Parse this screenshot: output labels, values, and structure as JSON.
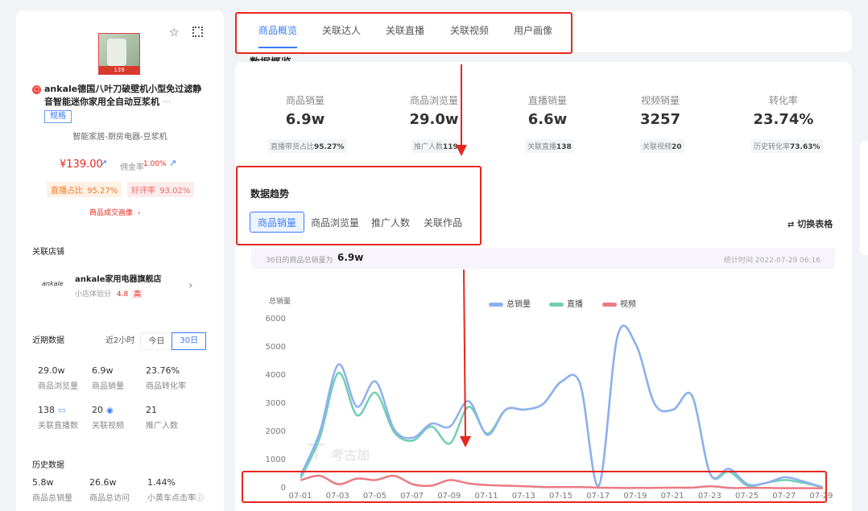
{
  "product": {
    "title": "ankale德国八叶刀破壁机小型免过滤静音智能迷你家用全自动豆浆机",
    "more": "···",
    "spec_tag": "规格",
    "category": "智能家居-厨房电器-豆浆机",
    "price": "¥139.00",
    "commission_label": "佣金率",
    "commission_value": "1.00%",
    "live_ratio_label": "直播占比",
    "live_ratio_value": "95.27%",
    "good_rate_label": "好评率",
    "good_rate_value": "93.02%",
    "deal_portrait_link": "商品成交画像",
    "image_text": "139"
  },
  "shop": {
    "section_title": "关联店铺",
    "logo_text": "ankale",
    "name": "ankale家用电器旗舰店",
    "score_label": "小店体验分",
    "score_value": "4.8",
    "score_level": "高"
  },
  "recent": {
    "section_title": "近期数据",
    "ranges": [
      "近2小时",
      "今日",
      "30日"
    ],
    "active_range": "30日",
    "stats": [
      {
        "value": "29.0w",
        "label": "商品浏览量"
      },
      {
        "value": "6.9w",
        "label": "商品销量"
      },
      {
        "value": "23.76%",
        "label": "商品转化率"
      },
      {
        "value": "138",
        "label": "关联直播数"
      },
      {
        "value": "20",
        "label": "关联视频"
      },
      {
        "value": "21",
        "label": "推广人数"
      }
    ]
  },
  "history": {
    "section_title": "历史数据",
    "stats": [
      {
        "value": "5.8w",
        "label": "商品总销量"
      },
      {
        "value": "26.6w",
        "label": "商品总访问"
      },
      {
        "value": "1.44%",
        "label": "小黄车点击率"
      }
    ]
  },
  "tabs": [
    "商品概览",
    "关联达人",
    "关联直播",
    "关联视频",
    "用户画像"
  ],
  "active_tab": "商品概览",
  "overview": {
    "heading_partial": "数据概览",
    "metrics": [
      {
        "label": "商品销量",
        "value": "6.9w",
        "sub_label": "直播带货占比",
        "sub_value": "95.27%"
      },
      {
        "label": "商品浏览量",
        "value": "29.0w",
        "sub_label": "推广人数",
        "sub_value": "119"
      },
      {
        "label": "直播销量",
        "value": "6.6w",
        "sub_label": "关联直播",
        "sub_value": "138"
      },
      {
        "label": "视频销量",
        "value": "3257",
        "sub_label": "关联视频",
        "sub_value": "20"
      },
      {
        "label": "转化率",
        "value": "23.74%",
        "sub_label": "历史转化率",
        "sub_value": "73.63%"
      }
    ]
  },
  "trend": {
    "title": "数据趋势",
    "subtabs": [
      "商品销量",
      "商品浏览量",
      "推广人数",
      "关联作品"
    ],
    "active_subtab": "商品销量",
    "toggle_table": "切换表格",
    "summary_label": "30日的商品总销量为",
    "summary_value": "6.9w",
    "stat_time": "统计时间 2022-07-29 06:16",
    "watermark": "考古加"
  },
  "colors": {
    "accent": "#3c7bf5",
    "annotation_red": "#e8261e",
    "total_line": "#8fb0ee",
    "live_line": "#6fcfb2",
    "video_line": "#eb7a83"
  },
  "chart_data": {
    "type": "line",
    "ylabel": "总销量",
    "ylim": [
      0,
      6000
    ],
    "yticks": [
      0,
      1000,
      2000,
      3000,
      4000,
      5000,
      6000
    ],
    "x": [
      "07-01",
      "07-02",
      "07-03",
      "07-04",
      "07-05",
      "07-06",
      "07-07",
      "07-08",
      "07-09",
      "07-10",
      "07-11",
      "07-12",
      "07-13",
      "07-14",
      "07-15",
      "07-16",
      "07-17",
      "07-18",
      "07-19",
      "07-20",
      "07-21",
      "07-22",
      "07-23",
      "07-24",
      "07-25",
      "07-26",
      "07-27",
      "07-28",
      "07-29"
    ],
    "xticks": [
      "07-01",
      "07-03",
      "07-05",
      "07-07",
      "07-09",
      "07-11",
      "07-13",
      "07-15",
      "07-17",
      "07-19",
      "07-21",
      "07-23",
      "07-25",
      "07-27",
      "07-29"
    ],
    "legend_position": "top",
    "grid": false,
    "series": [
      {
        "name": "总销量",
        "color": "#8fb0ee",
        "values": [
          500,
          2000,
          4400,
          2900,
          3800,
          2100,
          1800,
          2300,
          2200,
          3100,
          1900,
          2800,
          2800,
          3000,
          3800,
          3700,
          100,
          5400,
          5100,
          3000,
          2800,
          3300,
          500,
          700,
          150,
          200,
          400,
          250,
          50
        ]
      },
      {
        "name": "直播",
        "color": "#6fcfb2",
        "values": [
          400,
          1800,
          4100,
          2600,
          3400,
          2000,
          1700,
          2200,
          1600,
          2900,
          1950,
          2800,
          2800,
          3000,
          3800,
          3700,
          100,
          5400,
          5100,
          3000,
          2800,
          3300,
          500,
          600,
          100,
          200,
          300,
          200,
          50
        ]
      },
      {
        "name": "视频",
        "color": "#eb7a83",
        "values": [
          300,
          450,
          150,
          350,
          300,
          450,
          150,
          100,
          300,
          180,
          120,
          100,
          80,
          50,
          50,
          50,
          30,
          20,
          20,
          20,
          30,
          30,
          80,
          20,
          20,
          20,
          10,
          10,
          10
        ]
      }
    ]
  }
}
